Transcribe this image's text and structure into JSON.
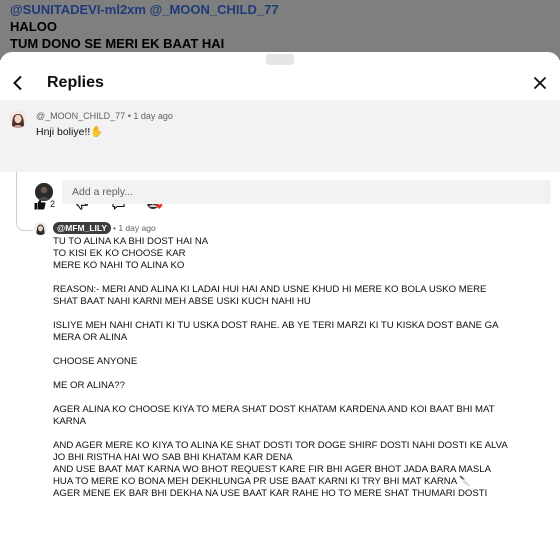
{
  "original_comment": {
    "mentions": "@SUNITADEVI-ml2xm @_MOON_CHILD_77",
    "line1": "HALOO",
    "line2": "TUM DONO SE MERI EK BAAT HAI"
  },
  "sheet": {
    "title": "Replies"
  },
  "parent_reply": {
    "author": "@_MOON_CHILD_77",
    "time": "1 day ago",
    "text": "Hnji boliye!!✋",
    "like_count": "2"
  },
  "add_reply": {
    "placeholder": "Add a reply..."
  },
  "reply2": {
    "author": "@MFM_LILY",
    "time": "1 day ago",
    "lines": [
      "TU TO ALINA KA BHI DOST HAI NA",
      "TO KISI EK KO CHOOSE KAR",
      "MERE KO NAHI TO ALINA KO",
      "",
      "REASON:- MERI AND ALINA KI LADAI HUI HAI AND USNE KHUD HI MERE KO BOLA USKO MERE",
      "SHAT BAAT NAHI KARNI MEH ABSE USKI KUCH NAHI HU",
      "",
      "ISLIYE MEH NAHI CHATI KI TU USKA DOST RAHE. AB YE TERI MARZI KI TU KISKA DOST BANE GA",
      "MERA OR ALINA",
      "",
      "CHOOSE ANYONE",
      "",
      "ME OR ALINA??",
      "",
      "AGER ALINA KO CHOOSE KIYA TO MERA SHAT DOST KHATAM KARDENA AND KOI BAAT BHI MAT",
      "KARNA",
      "",
      "AND AGER MERE KO KIYA TO ALINA KE SHAT DOSTI TOR DOGE SHIRF DOSTI NAHI DOSTI KE ALVA",
      "JO BHI RISTHA HAI WO SAB BHI KHATAM KAR DENA",
      "AND USE BAAT MAT KARNA WO BHOT REQUEST KARE FIR BHI AGER BHOT JADA BARA MASLA",
      "HUA TO MERE KO BONA MEH DEKHLUNGA PR USE BAAT KARNI KI TRY BHI MAT KARNA 🔪",
      "AGER MENE EK BAR BHI DEKHA NA USE BAAT KAR RAHE HO TO MERE SHAT THUMARI DOSTI"
    ]
  }
}
